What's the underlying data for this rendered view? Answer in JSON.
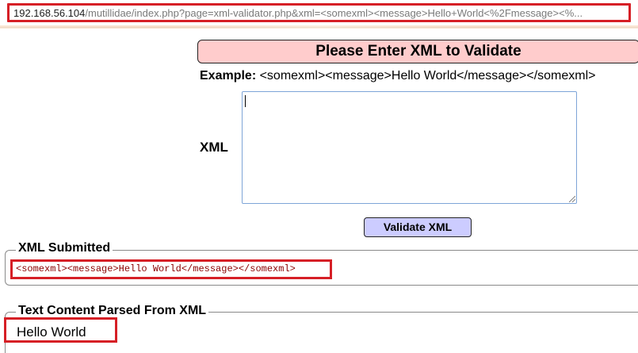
{
  "address_bar": {
    "host": "192.168.56.104",
    "path": "/mutillidae/index.php?page=xml-validator.php&xml=<somexml><message>Hello+World<%2Fmessage><%..."
  },
  "form": {
    "header": "Please Enter XML to Validate",
    "example_label": "Example:",
    "example_value": " <somexml><message>Hello World</message></somexml>",
    "xml_label": "XML",
    "xml_value": "",
    "validate_button": "Validate XML"
  },
  "results": {
    "submitted_legend": "XML Submitted",
    "submitted_value": "<somexml><message>Hello World</message></somexml>",
    "parsed_legend": "Text Content Parsed From XML",
    "parsed_value": "Hello World"
  },
  "colors": {
    "highlight": "#d61f26",
    "header_bg": "#ffcccc",
    "button_bg": "#ccccff",
    "submitted_text": "#8b0000"
  }
}
